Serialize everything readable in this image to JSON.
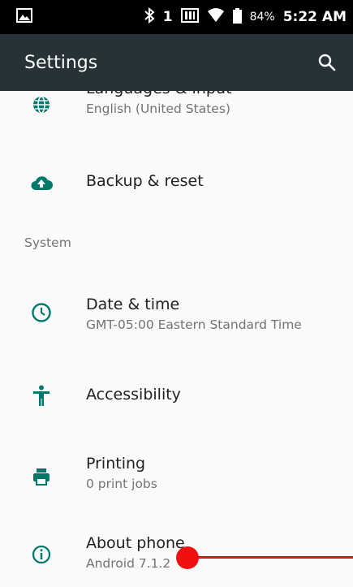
{
  "status_bar": {
    "sim_number": "1",
    "battery_percent": "84%",
    "time": "5:22 AM"
  },
  "app_bar": {
    "title": "Settings"
  },
  "settings": {
    "languages": {
      "title": "Languages & input",
      "summary": "English (United States)"
    },
    "backup": {
      "title": "Backup & reset"
    },
    "system_header": "System",
    "date_time": {
      "title": "Date & time",
      "summary": "GMT-05:00 Eastern Standard Time"
    },
    "accessibility": {
      "title": "Accessibility"
    },
    "printing": {
      "title": "Printing",
      "summary": "0 print jobs"
    },
    "about": {
      "title": "About phone",
      "summary": "Android 7.1.2"
    }
  },
  "colors": {
    "accent": "#00796b",
    "app_bar": "#263238",
    "touch_indicator": "#f01010"
  }
}
